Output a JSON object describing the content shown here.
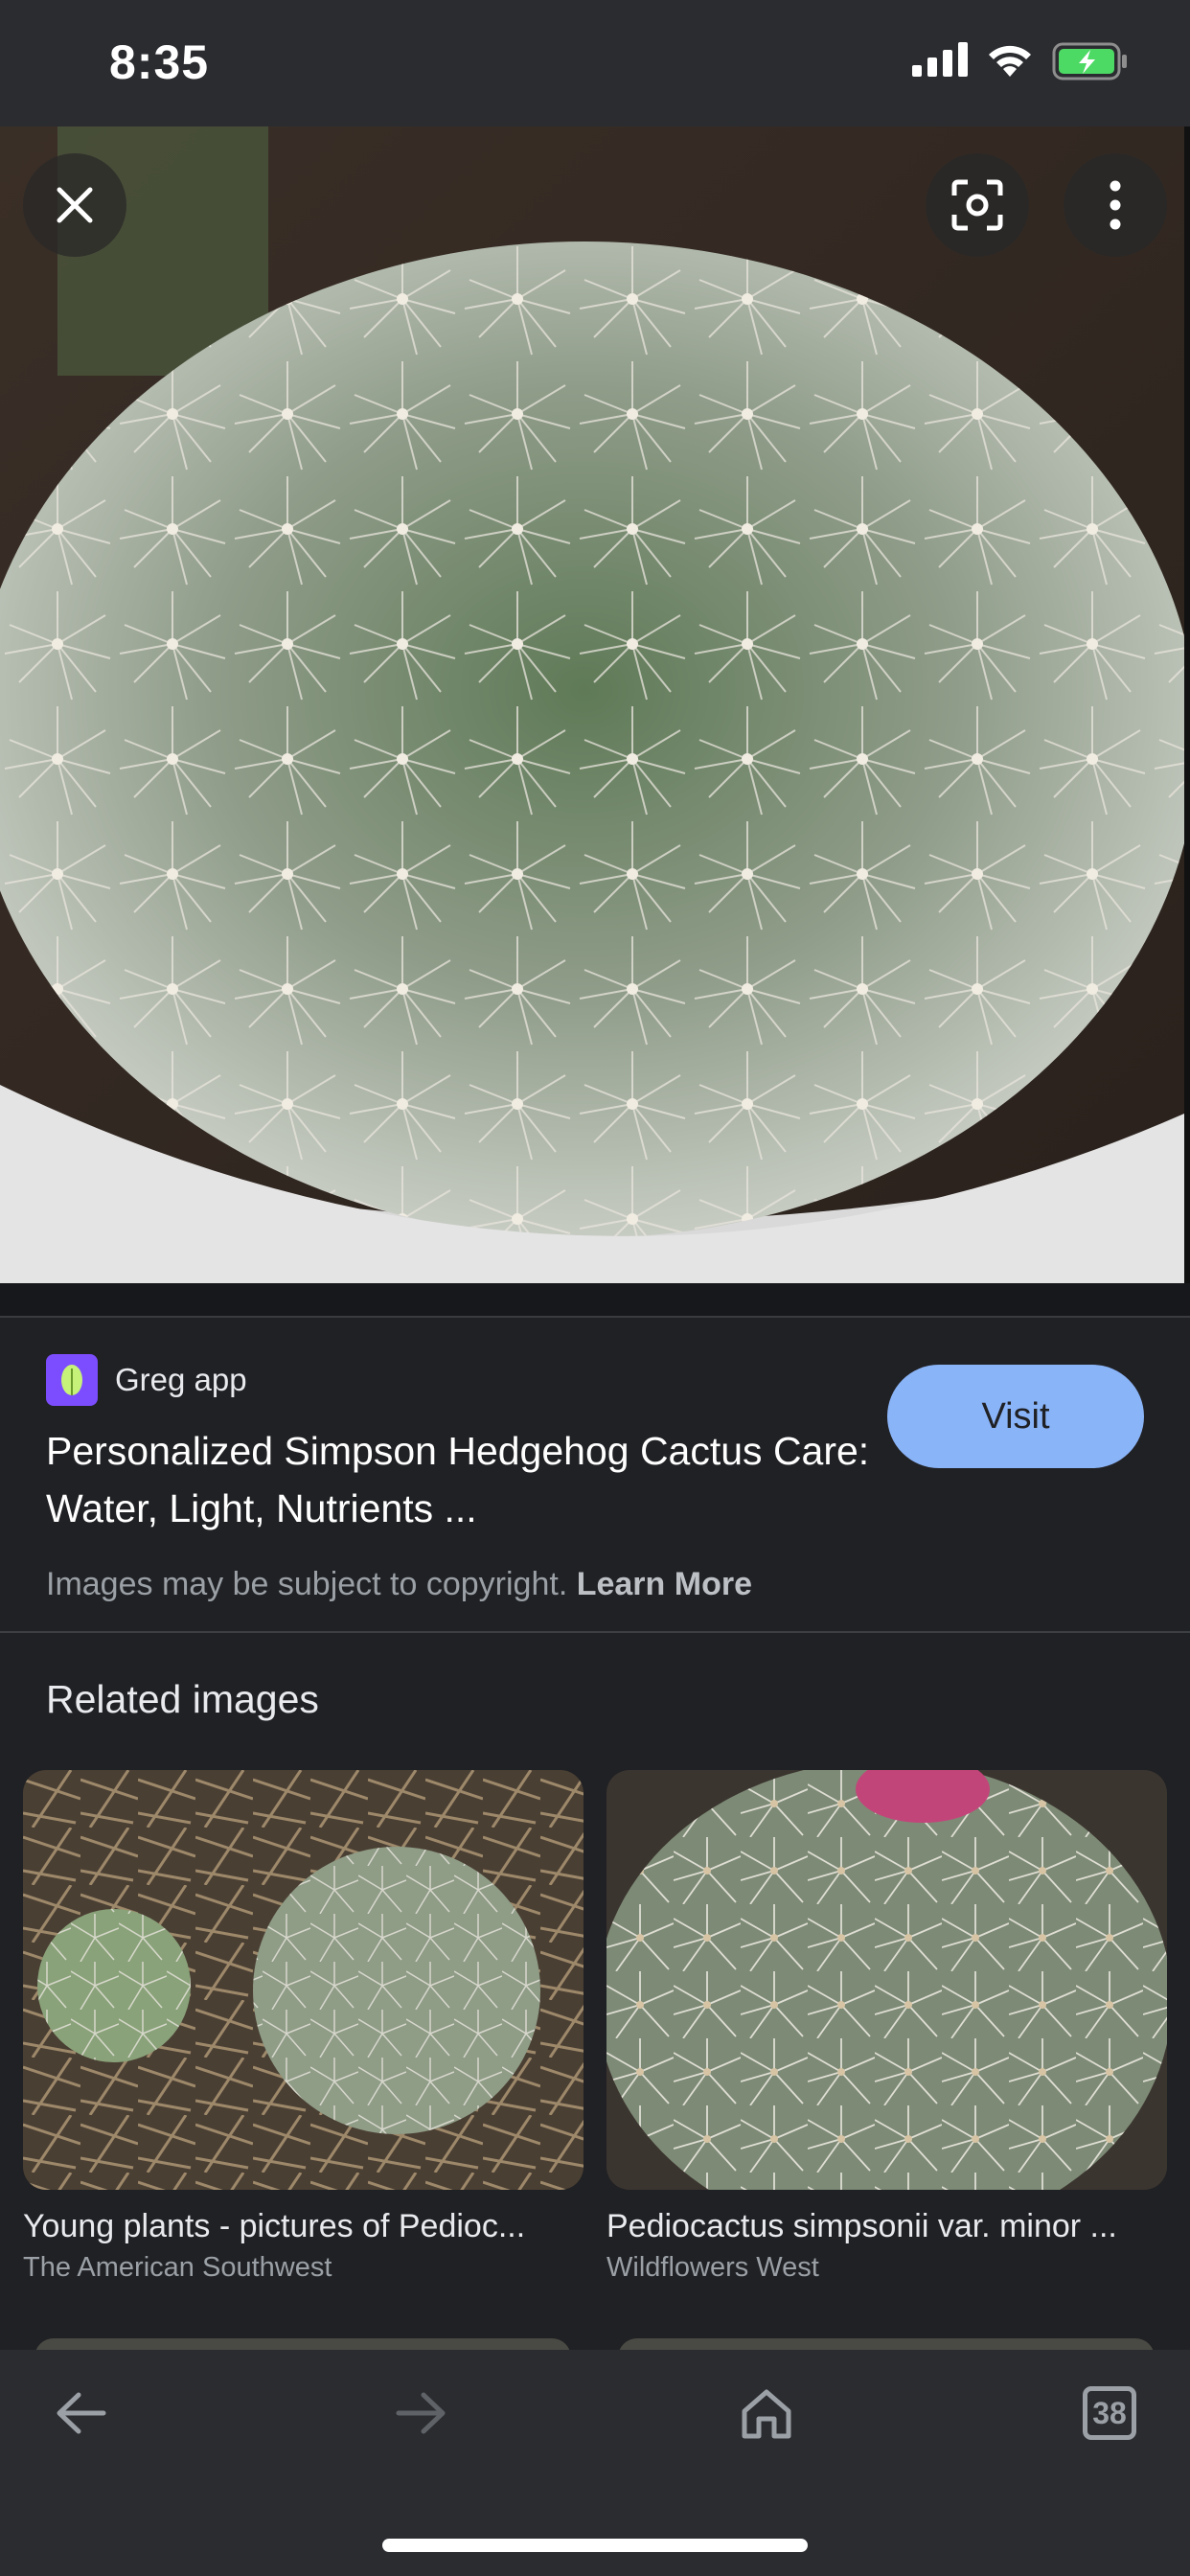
{
  "status_bar": {
    "time": "8:35"
  },
  "viewer": {
    "close_icon": "close-icon",
    "lens_icon": "lens-icon",
    "more_icon": "more-vert-icon"
  },
  "result": {
    "source_name": "Greg app",
    "title": "Personalized Simpson Hedgehog Cactus Care: Water, Light, Nutrients ...",
    "visit_label": "Visit",
    "copyright_text": "Images may be subject to copyright.",
    "learn_more_label": "Learn More"
  },
  "related": {
    "heading": "Related images",
    "items": [
      {
        "caption": "Young plants - pictures of Pedioc...",
        "source": "The American Southwest"
      },
      {
        "caption": "Pediocactus simpsonii var. minor ...",
        "source": "Wildflowers West"
      }
    ]
  },
  "bottom_nav": {
    "back_icon": "arrow-back-icon",
    "forward_icon": "arrow-forward-icon",
    "home_icon": "home-icon",
    "tab_count": "38"
  },
  "colors": {
    "background": "#202124",
    "bar": "#2b2c30",
    "visit_button": "#8ab4f8"
  }
}
